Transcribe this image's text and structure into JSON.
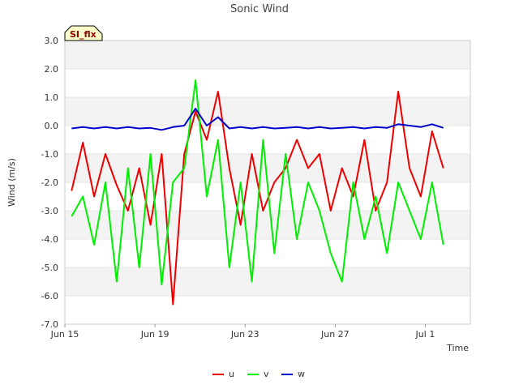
{
  "chart_data": {
    "type": "line",
    "title": "Sonic Wind",
    "xlabel": "Time",
    "ylabel": "Wind (m/s)",
    "badge": "SI_flx",
    "ylim": [
      -7.0,
      3.0
    ],
    "yticks": [
      "-7.0",
      "-6.0",
      "-5.0",
      "-4.0",
      "-3.0",
      "-2.0",
      "-1.0",
      "0.0",
      "1.0",
      "2.0",
      "3.0"
    ],
    "xlim_days": [
      0,
      18
    ],
    "xticks": [
      {
        "day": 0,
        "label": "Jun 15"
      },
      {
        "day": 4,
        "label": "Jun 19"
      },
      {
        "day": 8,
        "label": "Jun 23"
      },
      {
        "day": 12,
        "label": "Jun 27"
      },
      {
        "day": 16,
        "label": "Jul 1"
      }
    ],
    "x_days": [
      0.3,
      0.8,
      1.3,
      1.8,
      2.3,
      2.8,
      3.3,
      3.8,
      4.3,
      4.8,
      5.3,
      5.8,
      6.3,
      6.8,
      7.3,
      7.8,
      8.3,
      8.8,
      9.3,
      9.8,
      10.3,
      10.8,
      11.3,
      11.8,
      12.3,
      12.8,
      13.3,
      13.8,
      14.3,
      14.8,
      15.3,
      15.8,
      16.3,
      16.8
    ],
    "series": [
      {
        "name": "u",
        "color": "#ee0000",
        "values": [
          -2.3,
          -0.6,
          -2.5,
          -1.0,
          -2.1,
          -3.0,
          -1.5,
          -3.5,
          -1.0,
          -6.3,
          -1.0,
          0.5,
          -0.5,
          1.2,
          -1.5,
          -3.5,
          -1.0,
          -3.0,
          -2.0,
          -1.5,
          -0.5,
          -1.5,
          -1.0,
          -3.0,
          -1.5,
          -2.5,
          -0.5,
          -3.0,
          -2.0,
          1.2,
          -1.5,
          -2.5,
          -0.2,
          -1.5
        ]
      },
      {
        "name": "v",
        "color": "#00ee00",
        "values": [
          -3.2,
          -2.5,
          -4.2,
          -2.0,
          -5.5,
          -1.5,
          -5.0,
          -1.0,
          -5.6,
          -2.0,
          -1.5,
          1.6,
          -2.5,
          -0.5,
          -5.0,
          -2.0,
          -5.5,
          -0.5,
          -4.5,
          -1.0,
          -4.0,
          -2.0,
          -3.0,
          -4.5,
          -5.5,
          -2.0,
          -4.0,
          -2.5,
          -4.5,
          -2.0,
          -3.0,
          -4.0,
          -2.0,
          -4.2
        ]
      },
      {
        "name": "w",
        "color": "#0000cc",
        "values": [
          -0.1,
          -0.05,
          -0.1,
          -0.05,
          -0.1,
          -0.05,
          -0.1,
          -0.08,
          -0.15,
          -0.05,
          0.0,
          0.6,
          0.0,
          0.3,
          -0.1,
          -0.05,
          -0.1,
          -0.05,
          -0.1,
          -0.08,
          -0.05,
          -0.1,
          -0.05,
          -0.1,
          -0.08,
          -0.05,
          -0.1,
          -0.05,
          -0.08,
          0.05,
          0.0,
          -0.05,
          0.05,
          -0.08
        ]
      }
    ],
    "grid": true,
    "legend_position": "bottom-center"
  }
}
